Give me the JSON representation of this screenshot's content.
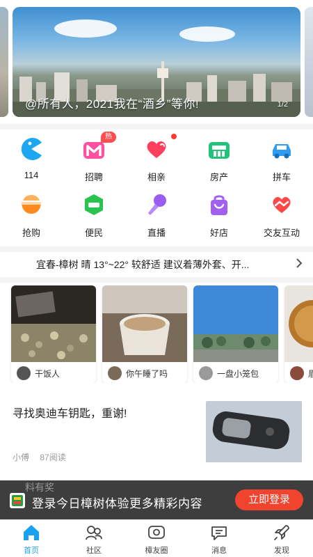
{
  "banner": {
    "caption": "@所有人，2021我在“酒乡”等你!",
    "counter": "1/2"
  },
  "services": [
    {
      "label": "114",
      "icon": "pacman-icon",
      "color": "#1da7f2"
    },
    {
      "label": "招聘",
      "icon": "recruit-m-icon",
      "color": "#ff4fa0",
      "badge": "热"
    },
    {
      "label": "相亲",
      "icon": "hearts-icon",
      "color": "#ff3f5e"
    },
    {
      "label": "房产",
      "icon": "house-icon",
      "color": "#22c27a"
    },
    {
      "label": "拼车",
      "icon": "car-icon",
      "color": "#2f9cf0"
    },
    {
      "label": "抢购",
      "icon": "bowl-icon",
      "color": "#ff8a1f"
    },
    {
      "label": "便民",
      "icon": "convenience-icon",
      "color": "#29c34f"
    },
    {
      "label": "直播",
      "icon": "microphone-icon",
      "color": "#9b5cf0"
    },
    {
      "label": "好店",
      "icon": "shopping-bag-icon",
      "color": "#a25ff2"
    },
    {
      "label": "交友互动",
      "icon": "handshake-heart-icon",
      "color": "#ff4747"
    }
  ],
  "weather": {
    "text": "宜春-樟树 晴 13°~22° 较舒适 建议着薄外套、开..."
  },
  "cards": [
    {
      "name": "干饭人"
    },
    {
      "name": "你午睡了吗"
    },
    {
      "name": "一盘小笼包"
    },
    {
      "name": "眉"
    }
  ],
  "article": {
    "title": "寻找奥迪车钥匙，重谢!",
    "author": "小傅",
    "reads": "87阅读"
  },
  "login": {
    "peek_text": "料有奖",
    "prompt": "登录今日樟树体验更多精彩内容",
    "button": "立即登录"
  },
  "tabs": [
    {
      "label": "首页",
      "icon": "home-icon",
      "active": true
    },
    {
      "label": "社区",
      "icon": "community-icon"
    },
    {
      "label": "樟友圈",
      "icon": "moments-icon"
    },
    {
      "label": "消息",
      "icon": "message-icon"
    },
    {
      "label": "发现",
      "icon": "rocket-icon"
    }
  ],
  "colors": {
    "accent": "#1ba1f2",
    "login_button": "#f0442f",
    "hot_badge": "#ff4d4f"
  }
}
